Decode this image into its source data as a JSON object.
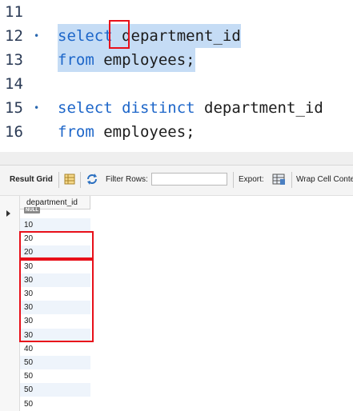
{
  "editor": {
    "lines": [
      {
        "number": "11",
        "dot": "",
        "parts": []
      },
      {
        "number": "12",
        "dot": "•",
        "parts": [
          {
            "text": "select",
            "kw": true
          },
          {
            "text": " department_id",
            "kw": false
          }
        ]
      },
      {
        "number": "13",
        "dot": "",
        "parts": [
          {
            "text": "from",
            "kw": true
          },
          {
            "text": " employees;",
            "kw": false
          }
        ]
      },
      {
        "number": "14",
        "dot": "",
        "parts": []
      },
      {
        "number": "15",
        "dot": "•",
        "parts": [
          {
            "text": "select",
            "kw": true
          },
          {
            "text": " ",
            "kw": false
          },
          {
            "text": "distinct",
            "kw": true
          },
          {
            "text": " department_id",
            "kw": false
          }
        ]
      },
      {
        "number": "16",
        "dot": "",
        "parts": [
          {
            "text": "from",
            "kw": true
          },
          {
            "text": " employees;",
            "kw": false
          }
        ]
      }
    ],
    "keyword_color": "#1d66c9",
    "selection_color": "#c5dcf5",
    "annotation_color": "#e8101a"
  },
  "toolbar": {
    "result_grid_label": "Result Grid",
    "filter_rows_label": "Filter Rows:",
    "filter_value": "",
    "export_label": "Export:",
    "wrap_label": "Wrap Cell Conte"
  },
  "grid": {
    "column_header": "department_id",
    "null_label": "NULL",
    "rows": [
      "10",
      "20",
      "20",
      "30",
      "30",
      "30",
      "30",
      "30",
      "30",
      "40",
      "50",
      "50",
      "50",
      "50"
    ]
  }
}
